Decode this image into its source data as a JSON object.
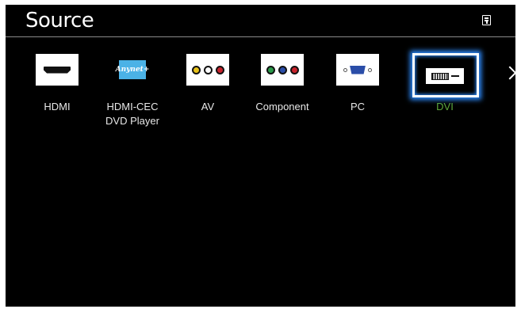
{
  "header": {
    "title": "Source",
    "tools_icon": "tools-menu-icon"
  },
  "sources": [
    {
      "label": "HDMI",
      "icon": "hdmi-port-icon",
      "selected": false
    },
    {
      "label": "HDMI-CEC\nDVD Player",
      "icon": "anynet-logo-icon",
      "selected": false
    },
    {
      "label": "AV",
      "icon": "av-jacks-icon",
      "selected": false
    },
    {
      "label": "Component",
      "icon": "component-jacks-icon",
      "selected": false
    },
    {
      "label": "PC",
      "icon": "vga-port-icon",
      "selected": true
    },
    {
      "label": "DVI",
      "icon": "dvi-port-icon",
      "selected": true
    }
  ],
  "anynet_logo_text": "Anynet+",
  "next_icon": "chevron-right-icon",
  "colors": {
    "background": "#000000",
    "selected_label": "#5ea83a",
    "focus_glow": "#2e8cff",
    "av_yellow": "#e8c21a",
    "av_white": "#ffffff",
    "av_red": "#c8232c",
    "comp_green": "#2a9a4a",
    "comp_blue": "#2a4da8",
    "comp_red": "#c8232c"
  }
}
